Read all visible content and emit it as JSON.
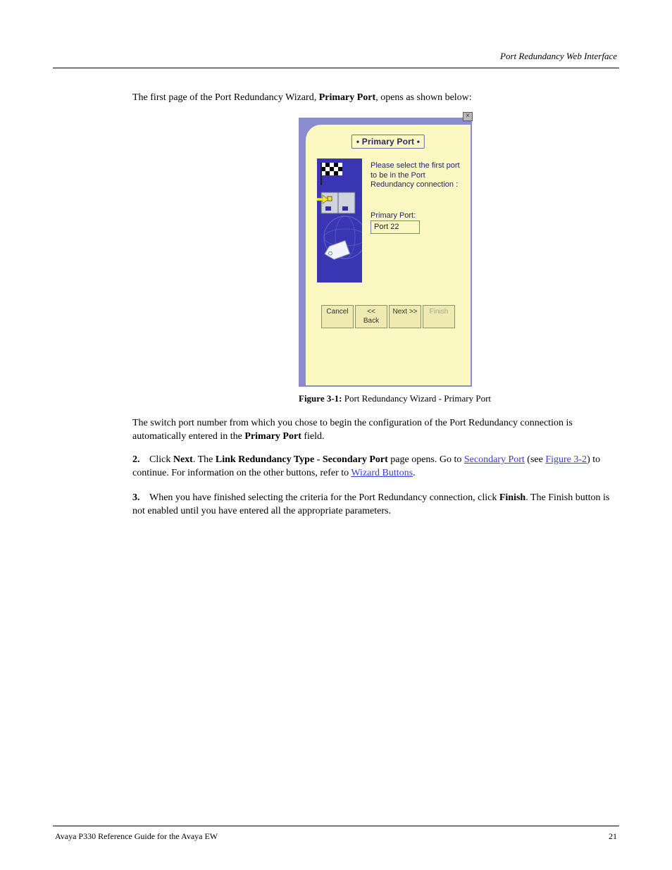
{
  "header": {
    "right_text": "Port Redundancy Web Interface"
  },
  "intro": {
    "p1_pre": "The first page of the Port Redundancy Wizard, ",
    "p1_bold": "Primary Port",
    "p1_post": ", opens as shown below:"
  },
  "dialog": {
    "close_glyph": "×",
    "title": "• Primary Port •",
    "instruction": "Please select the first port to be in the Port Redundancy connection :",
    "field_label": "Primary Port:",
    "field_value": "Port 22",
    "buttons": {
      "cancel": "Cancel",
      "back": "<< Back",
      "next": "Next >>",
      "finish": "Finish"
    }
  },
  "figure_caption": {
    "label": "Figure 3-1:",
    "text": "Port Redundancy Wizard - Primary Port"
  },
  "para_after_fig": {
    "pre": "The switch port number from which you chose to begin the configuration of the Port Redundancy connection is automatically entered in the ",
    "bold1": "Primary Port",
    "post": " field."
  },
  "steps": [
    {
      "num": "2.",
      "parts": [
        {
          "t": "Click "
        },
        {
          "t": "Next",
          "b": true
        },
        {
          "t": ". The "
        },
        {
          "t": "Link Redundancy Type - Secondary Port",
          "b": true
        },
        {
          "t": " page opens. Go to "
        },
        {
          "t": "Secondary Port",
          "link": true
        },
        {
          "t": " (see "
        },
        {
          "t": "Figure 3-2",
          "link": true
        },
        {
          "t": ") to continue. For information on the other buttons, refer to "
        },
        {
          "t": "Wizard Buttons",
          "link": true
        },
        {
          "t": "."
        }
      ]
    },
    {
      "num": "3.",
      "parts": [
        {
          "t": "When you have finished selecting the criteria for the Port Redundancy connection, click "
        },
        {
          "t": "Finish",
          "b": true
        },
        {
          "t": ". The Finish button is not enabled until you have entered all the appropriate parameters."
        }
      ]
    }
  ],
  "footer": {
    "left": "Avaya P330 Reference Guide for the Avaya EW",
    "right": "21"
  }
}
